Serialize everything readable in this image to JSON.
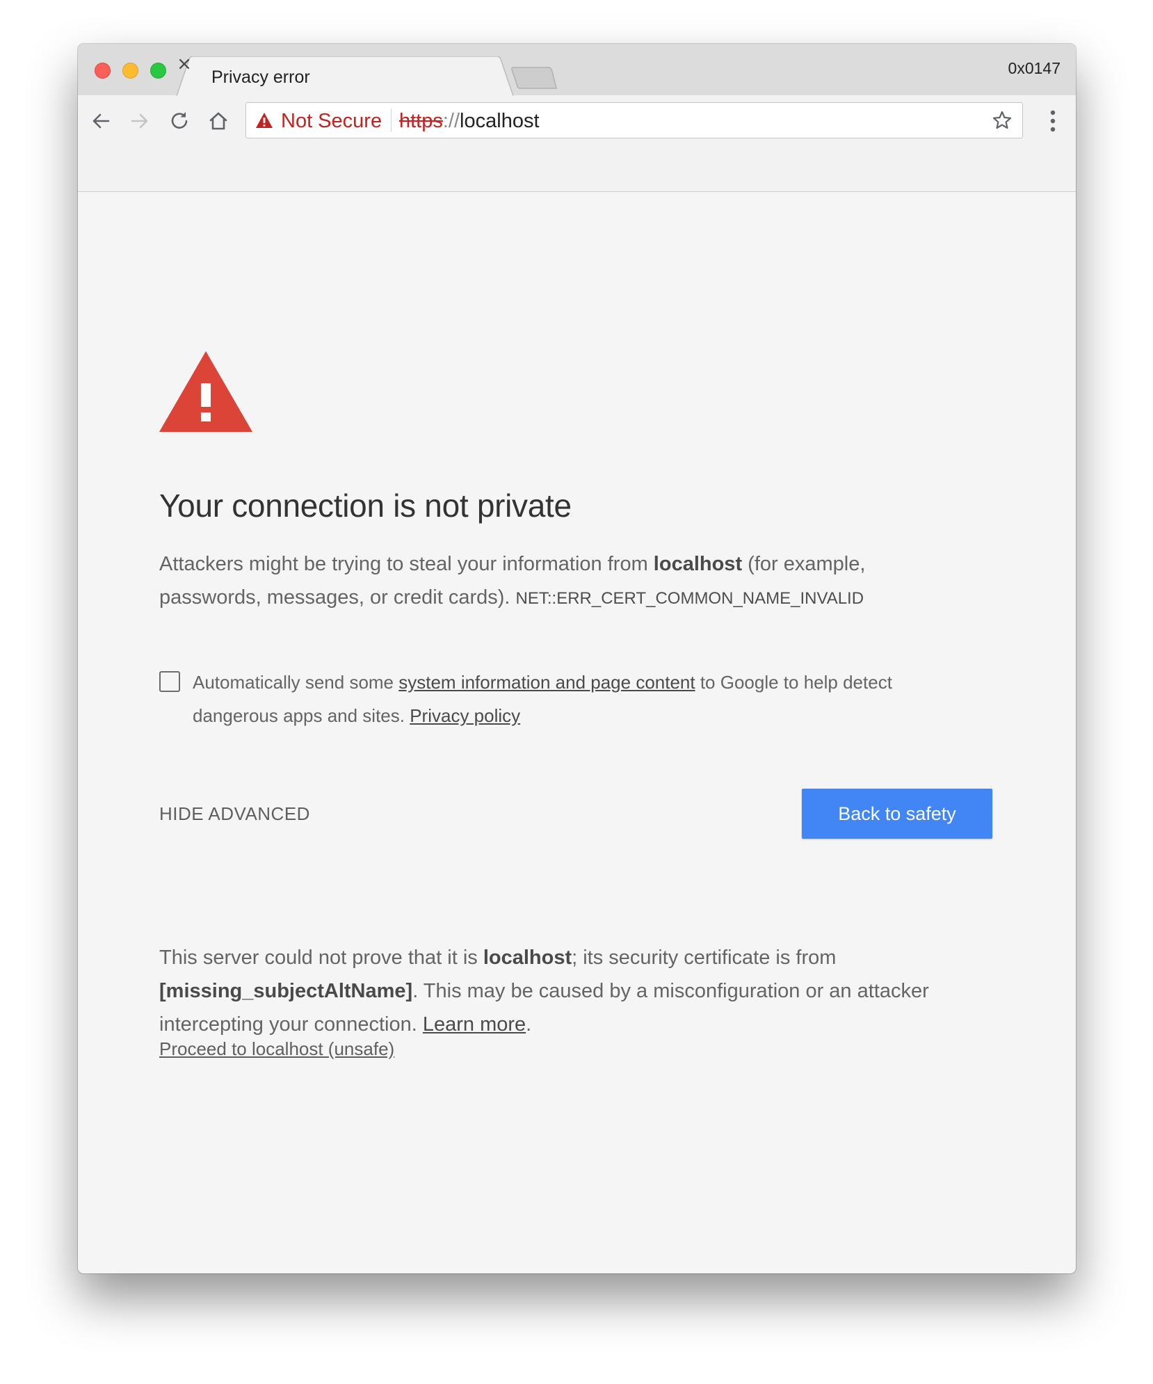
{
  "window": {
    "code": "0x0147"
  },
  "tab": {
    "title": "Privacy error"
  },
  "omnibox": {
    "security_label": "Not Secure",
    "url_scheme": "https",
    "url_separator": "://",
    "url_host": "localhost"
  },
  "interstitial": {
    "heading": "Your connection is not private",
    "intro_pre": "Attackers might be trying to steal your information from ",
    "intro_host": "localhost",
    "intro_post": " (for example, passwords, messages, or credit cards). ",
    "error_code": "NET::ERR_CERT_COMMON_NAME_INVALID",
    "report_pre": "Automatically send some ",
    "report_link": "system information and page content",
    "report_mid": " to Google to help detect dangerous apps and sites. ",
    "privacy_link": "Privacy policy",
    "hide_advanced": "HIDE ADVANCED",
    "back_button": "Back to safety",
    "detail_pre": "This server could not prove that it is ",
    "detail_host": "localhost",
    "detail_mid": "; its security certificate is from ",
    "detail_issuer": "[missing_subjectAltName]",
    "detail_post": ". This may be caused by a misconfiguration or an attacker intercepting your connection. ",
    "learn_more": "Learn more",
    "detail_end": ".",
    "proceed_link": "Proceed to localhost (unsafe)"
  },
  "icons": {
    "close_button": "traffic-light-close-icon",
    "minimize_button": "traffic-light-minimize-icon",
    "maximize_button": "traffic-light-maximize-icon",
    "tab_close": "close-icon",
    "back": "back-arrow-icon",
    "forward": "forward-arrow-icon",
    "reload": "reload-icon",
    "home": "home-icon",
    "security_warning": "warning-triangle-icon",
    "bookmark": "star-icon",
    "menu": "three-dots-menu-icon",
    "page_warning": "warning-triangle-icon"
  },
  "colors": {
    "danger": "#c5221f",
    "warning_icon": "#db4437",
    "primary_button": "#4285f4",
    "page_background": "#f5f5f5"
  }
}
